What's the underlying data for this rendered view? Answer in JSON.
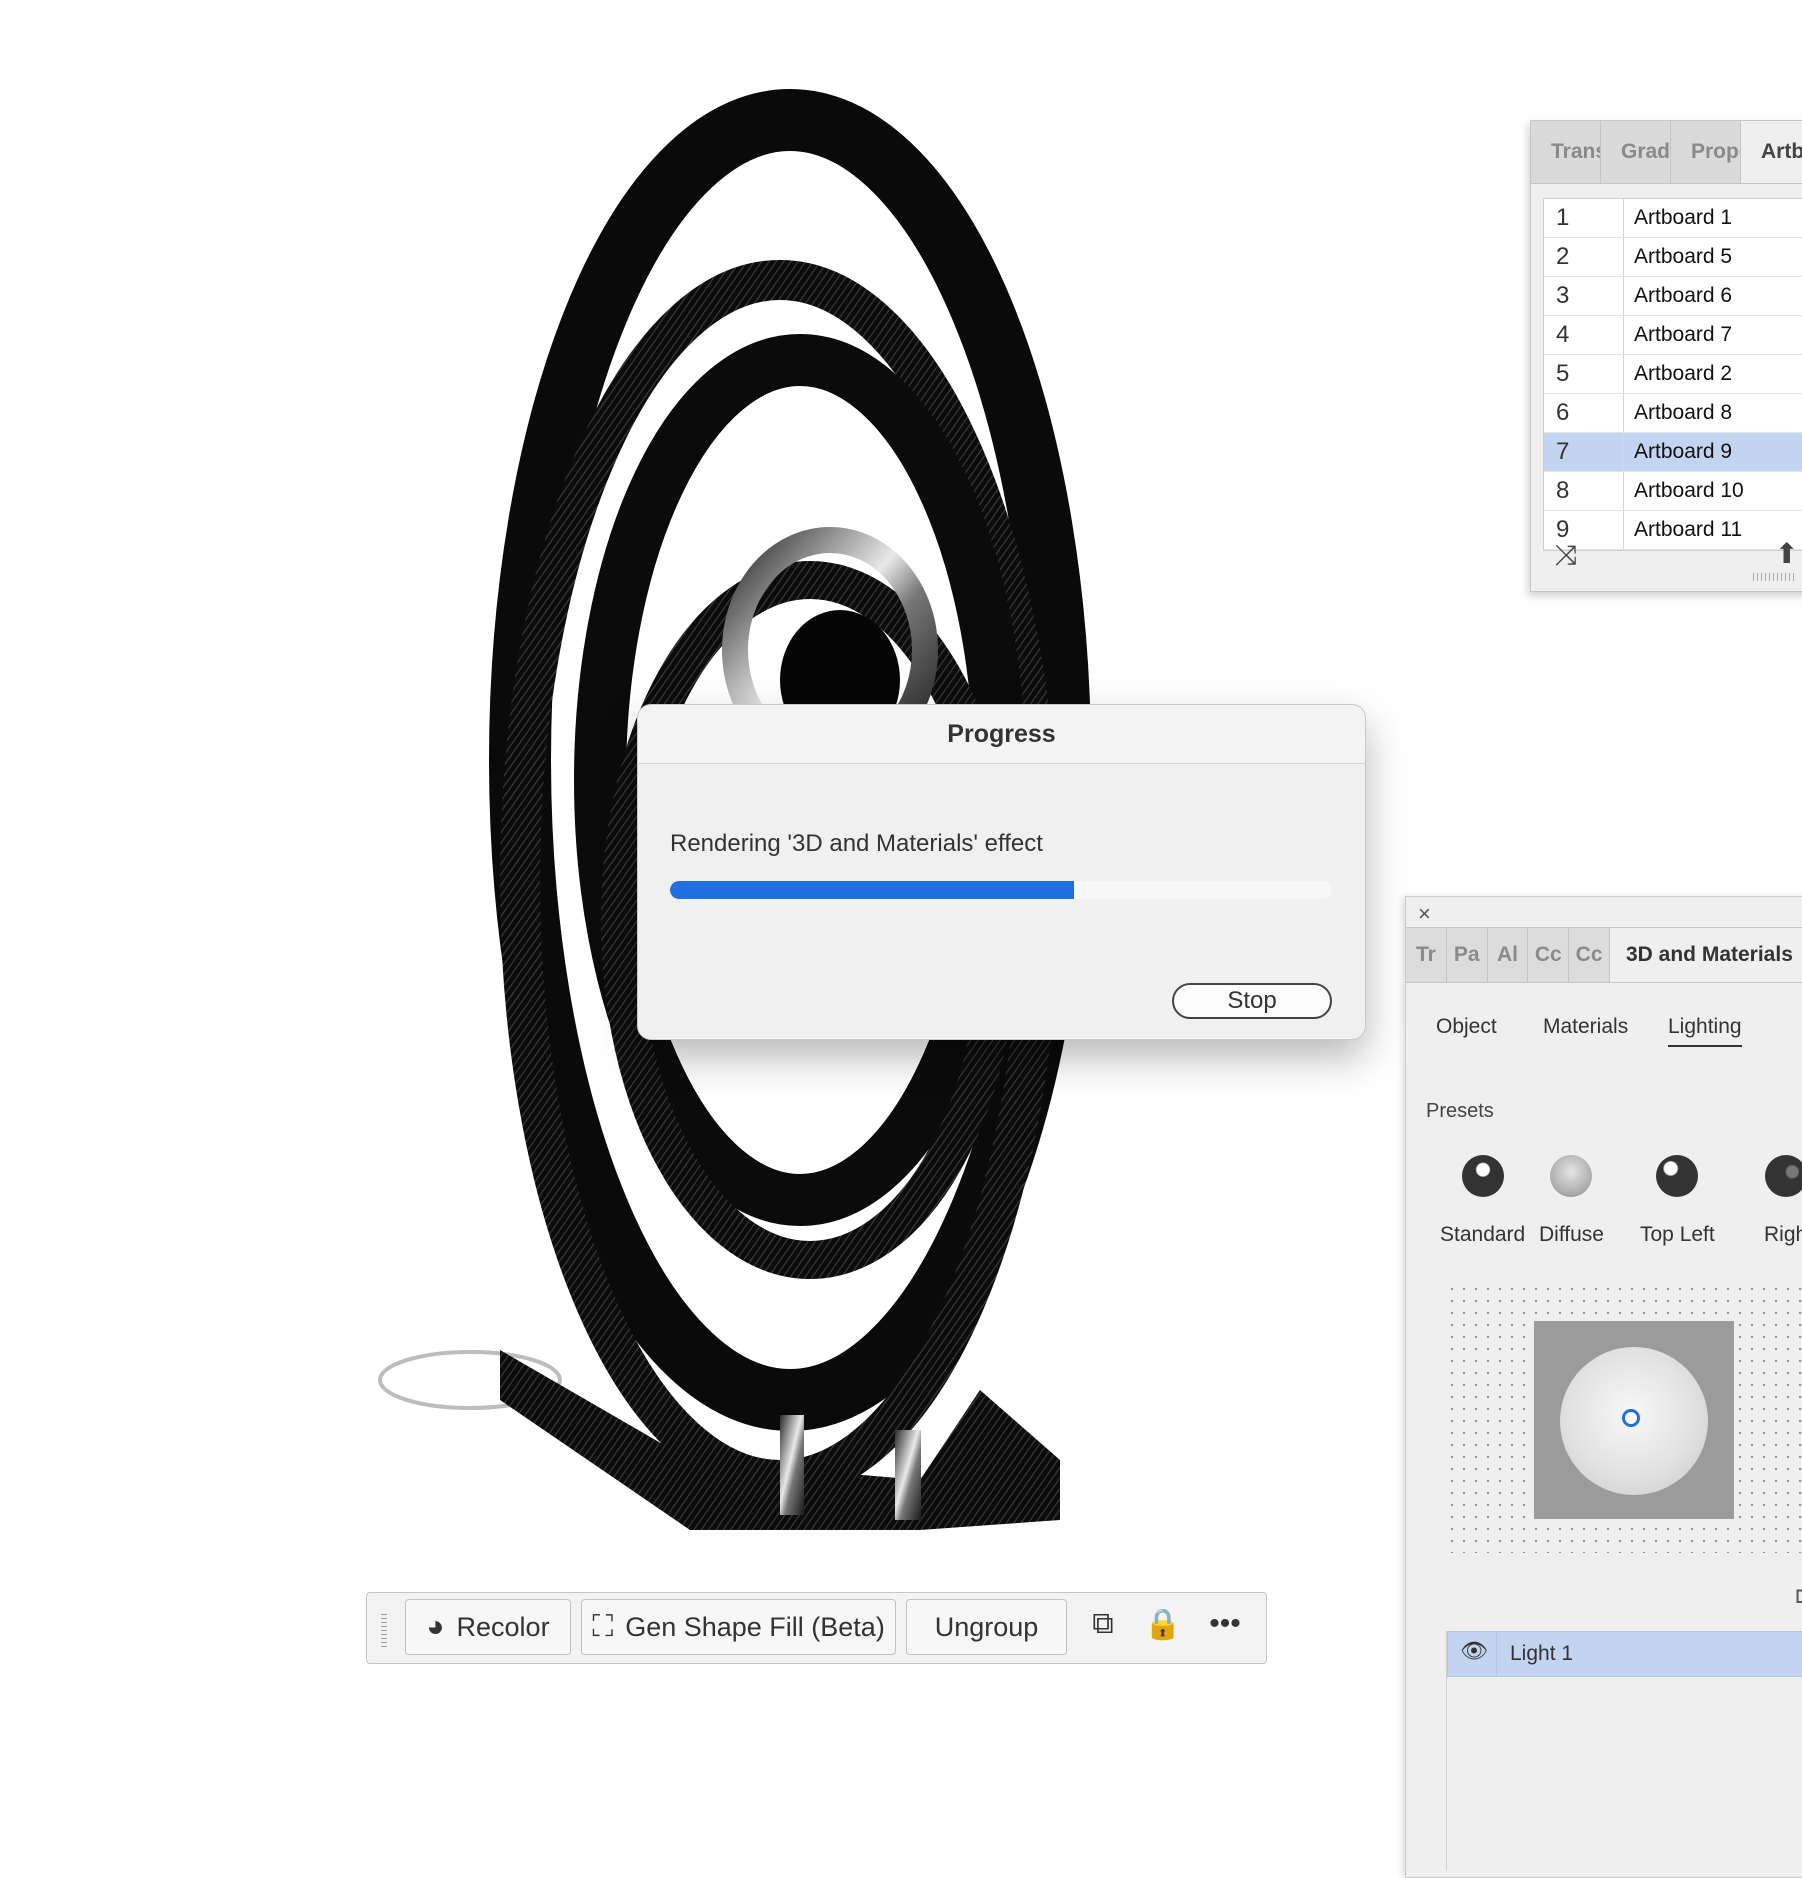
{
  "artboards_panel": {
    "tabs": [
      {
        "label": "Trans"
      },
      {
        "label": "Gradi"
      },
      {
        "label": "Prope"
      },
      {
        "label": "Artb",
        "active": true
      }
    ],
    "rows": [
      {
        "num": "1",
        "name": "Artboard 1"
      },
      {
        "num": "2",
        "name": "Artboard 5"
      },
      {
        "num": "3",
        "name": "Artboard 6"
      },
      {
        "num": "4",
        "name": "Artboard 7"
      },
      {
        "num": "5",
        "name": "Artboard 2"
      },
      {
        "num": "6",
        "name": "Artboard 8"
      },
      {
        "num": "7",
        "name": "Artboard 9",
        "selected": true
      },
      {
        "num": "8",
        "name": "Artboard 10"
      },
      {
        "num": "9",
        "name": "Artboard 11"
      }
    ],
    "rearrange_icon": "rearrange-icon",
    "move_up_icon": "arrow-up-icon"
  },
  "progress_dialog": {
    "title": "Progress",
    "message": "Rendering '3D and Materials' effect",
    "progress": 0.61,
    "accent": "#1f6fe0",
    "stop_label": "Stop"
  },
  "toolbar": {
    "recolor_label": "Recolor",
    "gen_shape_fill_label": "Gen Shape Fill (Beta)",
    "ungroup_label": "Ungroup",
    "icons": [
      "recolor-icon",
      "gen-shape-fill-icon",
      "duplicate-icon",
      "lock-icon",
      "more-icon"
    ]
  },
  "materials_panel": {
    "close_glyph": "×",
    "tabs": [
      {
        "label": "Tr"
      },
      {
        "label": "Pa"
      },
      {
        "label": "Al"
      },
      {
        "label": "Cc"
      },
      {
        "label": "Cc"
      },
      {
        "label": "3D and Materials",
        "active": true
      }
    ],
    "sub_tabs": [
      {
        "label": "Object"
      },
      {
        "label": "Materials"
      },
      {
        "label": "Lighting",
        "active": true
      }
    ],
    "presets_label": "Presets",
    "presets": [
      {
        "label": "Standard"
      },
      {
        "label": "Diffuse"
      },
      {
        "label": "Top Left"
      },
      {
        "label": "Righ"
      }
    ],
    "lights": [
      {
        "name": "Light 1",
        "selected": true
      }
    ]
  }
}
